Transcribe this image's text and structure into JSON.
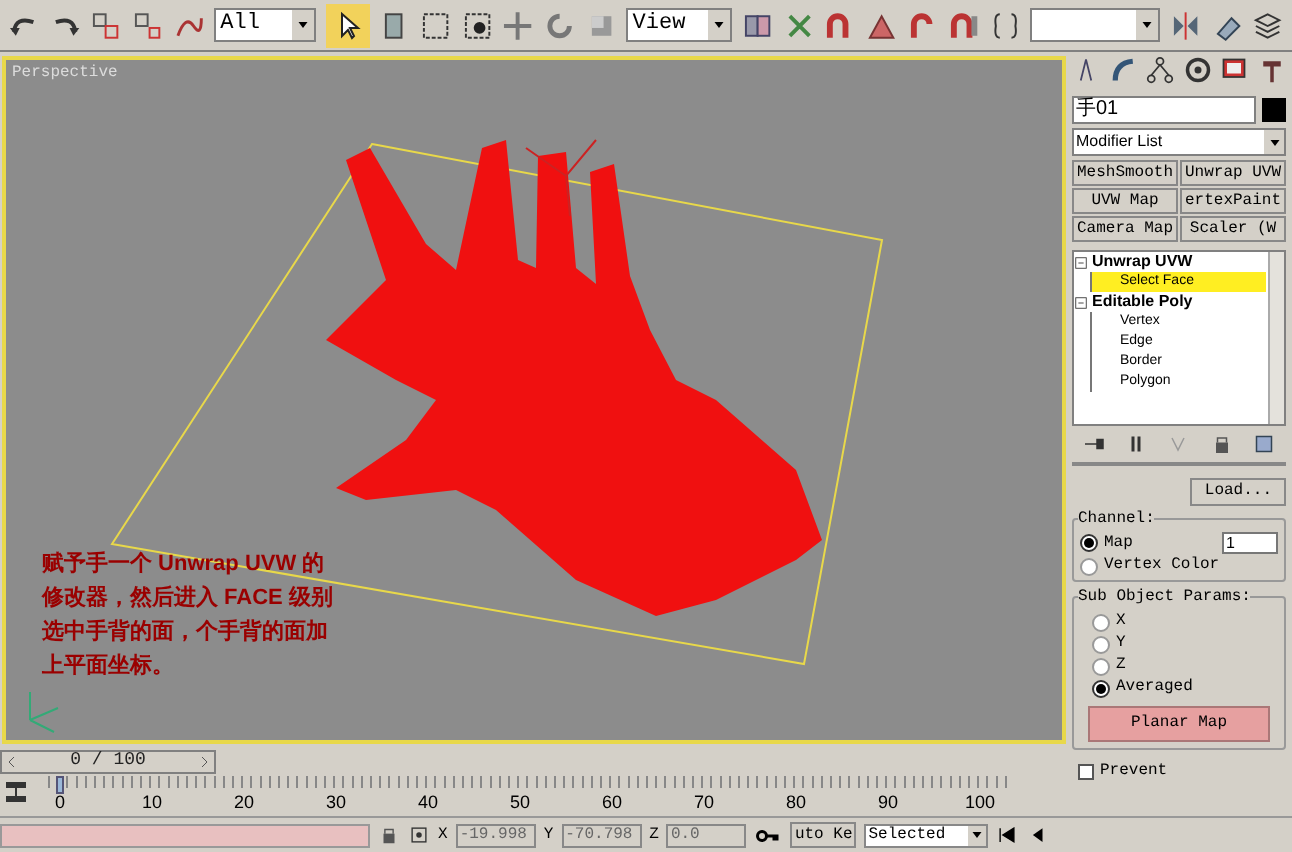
{
  "toolbar": {
    "selection_filter": "All",
    "reference_coordinate": "View"
  },
  "viewport": {
    "label": "Perspective",
    "note_lines": [
      "赋予手一个 Unwrap UVW 的",
      "修改器，然后进入 FACE 级别",
      "选中手背的面，个手背的面加",
      "上平面坐标。"
    ]
  },
  "command_panel": {
    "object_name": "手01",
    "modifier_list": "Modifier List",
    "modifier_buttons": [
      "MeshSmooth",
      "Unwrap UVW",
      "UVW Map",
      "ertexPaint",
      "Camera Map",
      "Scaler (W"
    ],
    "stack": [
      {
        "label": "Unwrap UVW",
        "expanded": true,
        "children": [
          {
            "label": "Select Face",
            "selected": true
          }
        ]
      },
      {
        "label": "Editable Poly",
        "expanded": true,
        "children": [
          {
            "label": "Vertex",
            "selected": false
          },
          {
            "label": "Edge",
            "selected": false
          },
          {
            "label": "Border",
            "selected": false
          },
          {
            "label": "Polygon",
            "selected": false
          }
        ]
      }
    ],
    "load_button": "Load...",
    "channel": {
      "title": "Channel:",
      "options": [
        {
          "label": "Map",
          "selected": true
        },
        {
          "label": "Vertex Color",
          "selected": false
        }
      ],
      "map_channel": "1"
    },
    "sub_object_params": {
      "title": "Sub Object Params:",
      "options": [
        {
          "label": "X",
          "selected": false
        },
        {
          "label": "Y",
          "selected": false
        },
        {
          "label": "Z",
          "selected": false
        },
        {
          "label": "Averaged",
          "selected": true
        }
      ],
      "button": "Planar Map"
    },
    "prevent": {
      "label": "Prevent",
      "checked": false
    }
  },
  "timeline": {
    "frame": "0 / 100",
    "level": 0,
    "ticks": [
      "0",
      "10",
      "20",
      "30",
      "40",
      "50",
      "60",
      "70",
      "80",
      "90",
      "100"
    ]
  },
  "status_bar": {
    "coordinates": [
      {
        "label": "X",
        "value": "-19.998"
      },
      {
        "label": "Y",
        "value": "-70.798"
      },
      {
        "label": "Z",
        "value": "0.0"
      }
    ],
    "auto_key": "uto Ke",
    "key_filter": "Selected"
  }
}
